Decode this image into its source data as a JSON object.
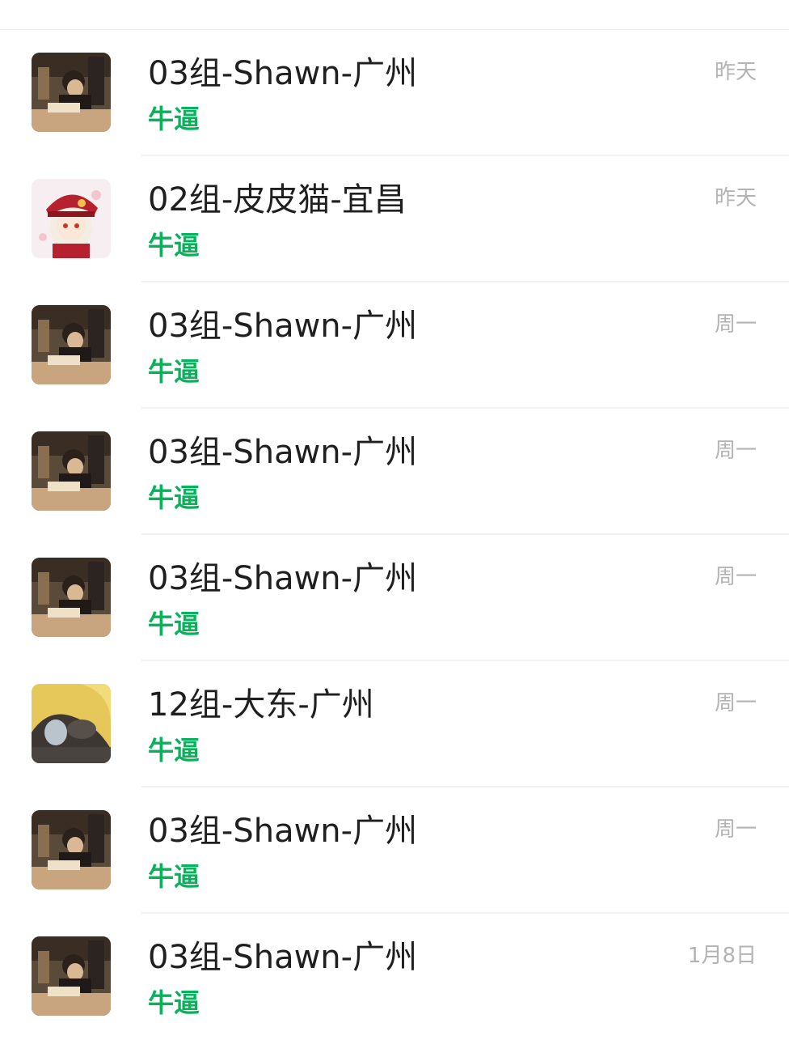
{
  "chats": [
    {
      "name": "03组-Shawn-广州",
      "preview": "牛逼",
      "time": "昨天",
      "avatar": "avatar-photo-shawn"
    },
    {
      "name": "02组-皮皮猫-宜昌",
      "preview": "牛逼",
      "time": "昨天",
      "avatar": "avatar-anime-girl"
    },
    {
      "name": "03组-Shawn-广州",
      "preview": "牛逼",
      "time": "周一",
      "avatar": "avatar-photo-shawn"
    },
    {
      "name": "03组-Shawn-广州",
      "preview": "牛逼",
      "time": "周一",
      "avatar": "avatar-photo-shawn"
    },
    {
      "name": "03组-Shawn-广州",
      "preview": "牛逼",
      "time": "周一",
      "avatar": "avatar-photo-shawn"
    },
    {
      "name": "12组-大东-广州",
      "preview": "牛逼",
      "time": "周一",
      "avatar": "avatar-photo-dadong"
    },
    {
      "name": "03组-Shawn-广州",
      "preview": "牛逼",
      "time": "周一",
      "avatar": "avatar-photo-shawn"
    },
    {
      "name": "03组-Shawn-广州",
      "preview": "牛逼",
      "time": "1月8日",
      "avatar": "avatar-photo-shawn"
    }
  ],
  "colors": {
    "preview_green": "#07b35a",
    "name_text": "#1f1f1f",
    "time_text": "#b3b3b3",
    "divider": "#f1f1f1"
  }
}
